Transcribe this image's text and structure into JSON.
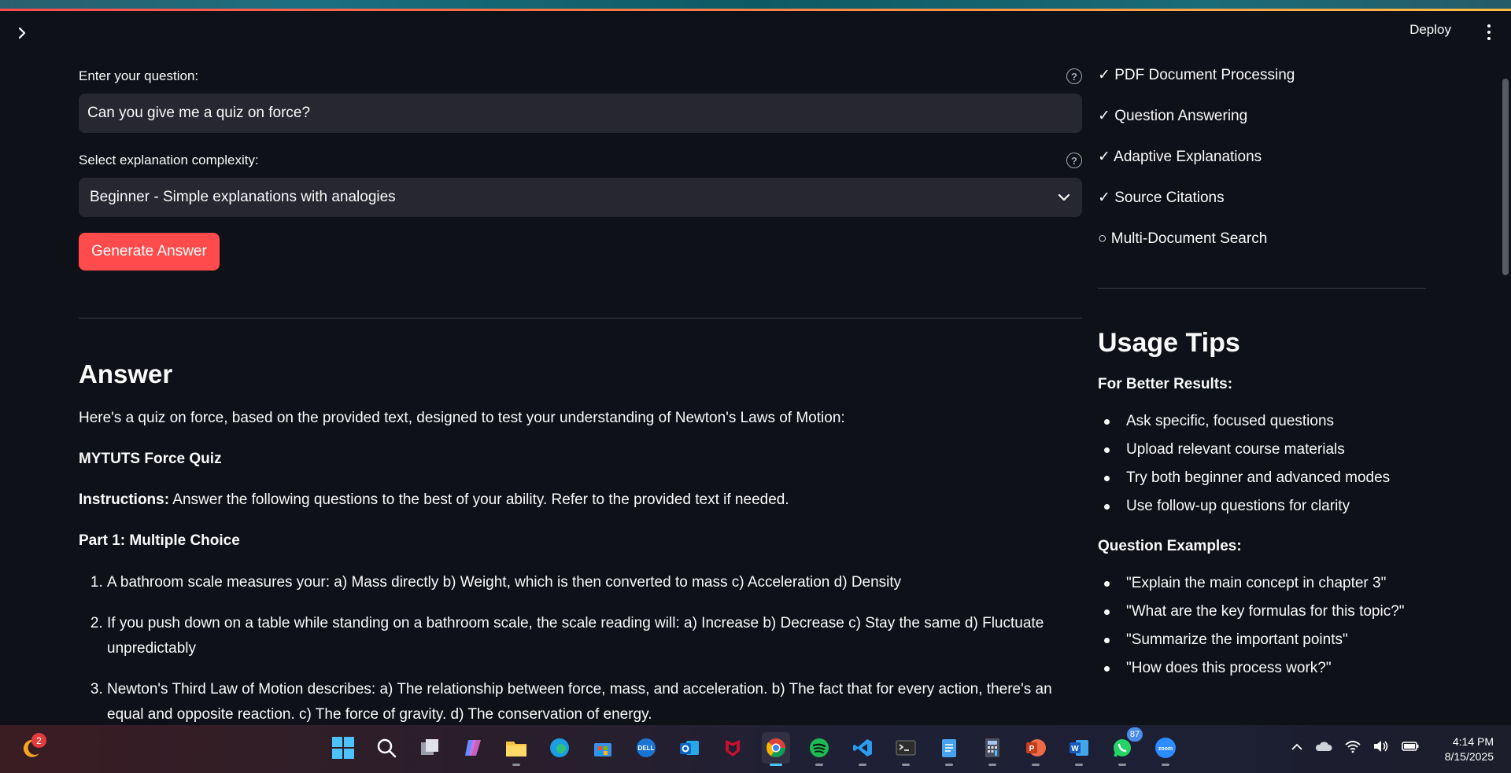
{
  "header": {
    "deploy_label": "Deploy"
  },
  "form": {
    "question_label": "Enter your question:",
    "question_value": "Can you give me a quiz on force?",
    "complexity_label": "Select explanation complexity:",
    "complexity_value": "Beginner - Simple explanations with analogies",
    "generate_label": "Generate Answer"
  },
  "answer": {
    "title": "Answer",
    "intro": "Here's a quiz on force, based on the provided text, designed to test your understanding of Newton's Laws of Motion:",
    "quiz_title": "MYTUTS Force Quiz",
    "instructions_label": "Instructions:",
    "instructions_text": " Answer the following questions to the best of your ability. Refer to the provided text if needed.",
    "part1_title": "Part 1: Multiple Choice",
    "questions": [
      "A bathroom scale measures your: a) Mass directly b) Weight, which is then converted to mass c) Acceleration d) Density",
      "If you push down on a table while standing on a bathroom scale, the scale reading will: a) Increase b) Decrease c) Stay the same d) Fluctuate unpredictably",
      "Newton's Third Law of Motion describes: a) The relationship between force, mass, and acceleration. b) The fact that for every action, there's an equal and opposite reaction. c) The force of gravity. d) The conservation of energy."
    ]
  },
  "sidebar": {
    "features": [
      "✓ PDF Document Processing",
      "✓ Question Answering",
      "✓ Adaptive Explanations",
      "✓ Source Citations",
      "○ Multi-Document Search"
    ],
    "tips_title": "Usage Tips",
    "better_results_title": "For Better Results:",
    "better_results": [
      "Ask specific, focused questions",
      "Upload relevant course materials",
      "Try both beginner and advanced modes",
      "Use follow-up questions for clarity"
    ],
    "examples_title": "Question Examples:",
    "examples": [
      "\"Explain the main concept in chapter 3\"",
      "\"What are the key formulas for this topic?\"",
      "\"Summarize the important points\"",
      "\"How does this process work?\""
    ]
  },
  "taskbar": {
    "widget_badge": "2",
    "whatsapp_badge": "87",
    "time": "4:14 PM",
    "date": "8/15/2025",
    "apps": [
      "start-icon",
      "search-icon",
      "task-view-icon",
      "copilot-icon",
      "file-explorer-icon",
      "edge-icon",
      "store-icon",
      "dell-icon",
      "outlook-icon",
      "mcafee-icon",
      "chrome-icon",
      "spotify-icon",
      "vscode-icon",
      "terminal-icon",
      "notepad-icon",
      "calculator-icon",
      "powerpoint-icon",
      "word-icon",
      "whatsapp-icon",
      "zoom-icon"
    ]
  }
}
